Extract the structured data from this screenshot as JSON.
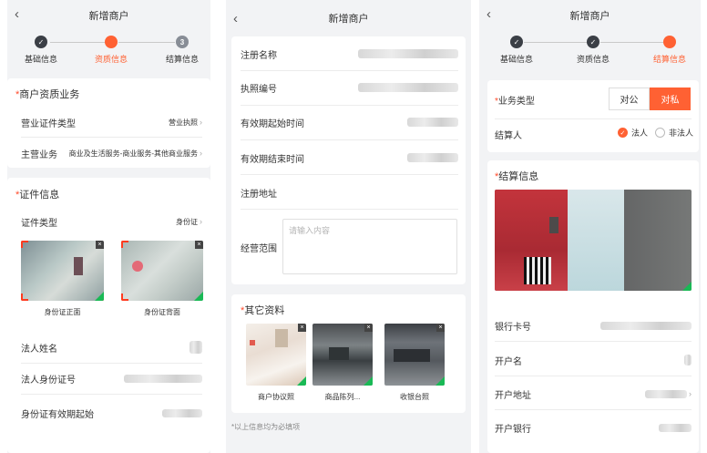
{
  "panel1": {
    "title": "新增商户",
    "steps": [
      {
        "label": "基础信息",
        "state": "done",
        "mark": ""
      },
      {
        "label": "资质信息",
        "state": "current",
        "mark": ""
      },
      {
        "label": "结算信息",
        "state": "todo",
        "mark": "3"
      }
    ],
    "qual_section": {
      "title": "商户资质业务",
      "req": "*"
    },
    "license_type": {
      "label": "营业证件类型",
      "value": "营业执照"
    },
    "main_business": {
      "label": "主营业务",
      "value": "商业及生活服务-商业服务-其他商业服务"
    },
    "cert_section": {
      "title": "证件信息",
      "req": "*"
    },
    "cert_type": {
      "label": "证件类型",
      "value": "身份证"
    },
    "id_front_caption": "身份证正面",
    "id_back_caption": "身份证背面",
    "legal_name_label": "法人姓名",
    "legal_id_label": "法人身份证号",
    "id_start_label": "身份证有效期起始"
  },
  "panel2": {
    "title": "新增商户",
    "fields": [
      {
        "label": "注册名称"
      },
      {
        "label": "执照编号"
      },
      {
        "label": "有效期起始时间"
      },
      {
        "label": "有效期结束时间"
      },
      {
        "label": "注册地址"
      }
    ],
    "scope_label": "经营范围",
    "scope_placeholder": "请输入内容",
    "other_section": {
      "title": "其它资料",
      "req": "*"
    },
    "photos": [
      {
        "caption": "商户协议照"
      },
      {
        "caption": "商品陈列..."
      },
      {
        "caption": "收银台照"
      }
    ],
    "note": "*以上信息均为必填项"
  },
  "panel3": {
    "title": "新增商户",
    "steps": [
      {
        "label": "基础信息",
        "state": "done",
        "mark": ""
      },
      {
        "label": "资质信息",
        "state": "done",
        "mark": ""
      },
      {
        "label": "结算信息",
        "state": "current",
        "mark": ""
      }
    ],
    "biz_type_label": "业务类型",
    "biz_type_req": "*",
    "biz_type_options": [
      "对公",
      "对私"
    ],
    "biz_type_selected": "对私",
    "settler_label": "结算人",
    "settler_options": [
      "法人",
      "非法人"
    ],
    "settler_selected": "法人",
    "settle_section": {
      "title": "结算信息",
      "req": "*"
    },
    "bank_card_label": "银行卡号",
    "account_name_label": "开户名",
    "bank_address_label": "开户地址",
    "bank_label": "开户银行"
  },
  "colors": {
    "accent": "#ff6133",
    "required": "#ff4a2b",
    "done": "#3b3f46",
    "success": "#19b955"
  }
}
